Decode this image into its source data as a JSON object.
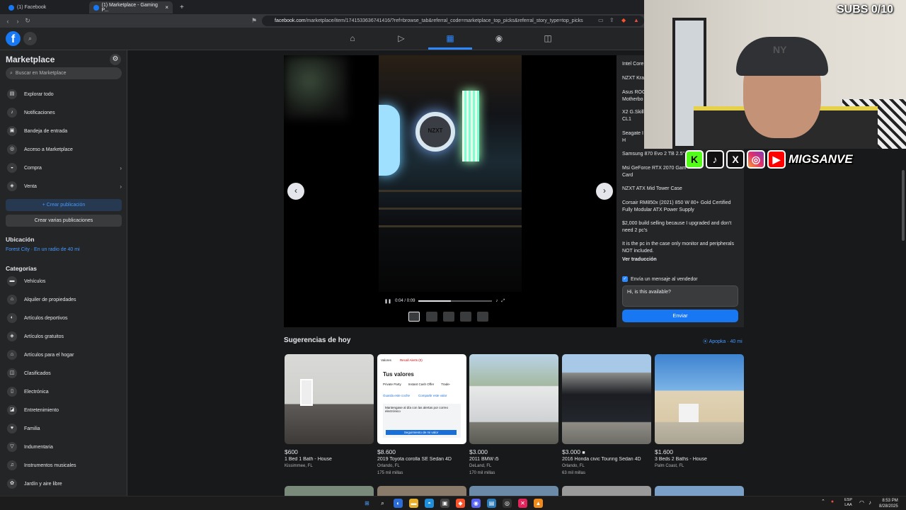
{
  "browser": {
    "tabs": [
      {
        "label": "(1) Facebook"
      },
      {
        "label": "(1) Marketplace - Gaming P..."
      }
    ],
    "new_tab": "+",
    "url_host": "facebook.com",
    "url_path": "/marketplace/item/1741533636741416/?ref=browse_tab&referral_code=marketplace_top_picks&referral_story_type=top_picks"
  },
  "fb": {
    "logo": "f"
  },
  "sidebar": {
    "title": "Marketplace",
    "search_placeholder": "Buscar en Marketplace",
    "items": [
      {
        "label": "Explorar todo",
        "icon": "store-icon"
      },
      {
        "label": "Notificaciones",
        "icon": "bell-icon"
      },
      {
        "label": "Bandeja de entrada",
        "icon": "inbox-icon"
      },
      {
        "label": "Acceso a Marketplace",
        "icon": "marketplace-access-icon"
      },
      {
        "label": "Compra",
        "icon": "bag-icon"
      },
      {
        "label": "Venta",
        "icon": "tag-icon"
      }
    ],
    "create_label": "+ Crear publicación",
    "create_multi_label": "Crear varias publicaciones",
    "location_heading": "Ubicación",
    "location_value": "Forest City · En un radio de 40 mi",
    "categories_heading": "Categorías",
    "categories": [
      "Vehículos",
      "Alquiler de propiedades",
      "Artículos deportivos",
      "Artículos gratuitos",
      "Artículos para el hogar",
      "Clasificados",
      "Electrónica",
      "Entretenimiento",
      "Familia",
      "Indumentaria",
      "Instrumentos musicales",
      "Jardín y aire libre"
    ]
  },
  "video": {
    "time": "0:04 / 0:09",
    "progress": 0.44,
    "brand_text": "NZXT"
  },
  "details": {
    "specs": [
      "Intel Core",
      "NZXT Kra",
      "Asus ROG Motherbo",
      "X2 G.Skill 3600 CL1",
      "Seagate I Internal H",
      "Samsung 870 Evo 2 TB 2.5\"",
      "Msi GeForce RTX 2070 Gam Card",
      "NZXT ATX Mid Tower Case",
      "Corsair RM850x (2021) 850 W 80+ Gold Certified Fully Modular ATX Power Supply",
      "$2,000 build selling because I upgraded and don't need 2 pc's",
      "It is the pc in the case only monitor and peripherals NOT included."
    ],
    "see_translation": "Ver traducción",
    "send_check_label": "Envía un mensaje al vendedor",
    "message": "Hi, is this available?",
    "send_label": "Enviar"
  },
  "suggestions": {
    "title": "Sugerencias de hoy",
    "location": "Apopka · 40 mi",
    "cards": [
      {
        "price": "$600",
        "name": "1 Bed 1 Bath - House",
        "loc": "Kissimmee, FL",
        "dist": ""
      },
      {
        "price": "$8.600",
        "name": "2019 Toyota corolla SE Sedan 4D",
        "loc": "Orlando, FL",
        "dist": "175 mil millas"
      },
      {
        "price": "$3.000",
        "name": "2011 BMW i5",
        "loc": "DeLand, FL",
        "dist": "170 mil millas"
      },
      {
        "price": "$3.000",
        "name": "2016 Honda civic Touring Sedan 4D",
        "loc": "Orlando, FL",
        "dist": "63 mil millas"
      },
      {
        "price": "$1.600",
        "name": "3 Beds 2 Baths - House",
        "loc": "Palm Coast, FL",
        "dist": ""
      }
    ],
    "card2_text": {
      "tab1": "Valores",
      "tab2": "Recall Alerts (0)",
      "heading": "Tus valores",
      "sub1": "Private Party",
      "sub2": "Instant Cash Offer",
      "sub3": "Trade-",
      "link1": "Guarda este coche",
      "link2": "Compartir este valor",
      "body": "Mantengase al día con las alertas por correo electrónico",
      "button": "Seguimiento de mi valor"
    }
  },
  "stream": {
    "subs": "SUBS 0/10",
    "social": [
      "K",
      "♪",
      "X",
      "◎",
      "▶"
    ],
    "handle": "MIGSANVE",
    "cap_logo": "NY"
  },
  "taskbar": {
    "lang": "ESP\nLAA",
    "time": "8:53 PM",
    "date": "8/28/2025"
  },
  "colors": {
    "accent": "#1877f2",
    "link": "#4599ff",
    "bg": "#18191a",
    "panel": "#242526"
  }
}
